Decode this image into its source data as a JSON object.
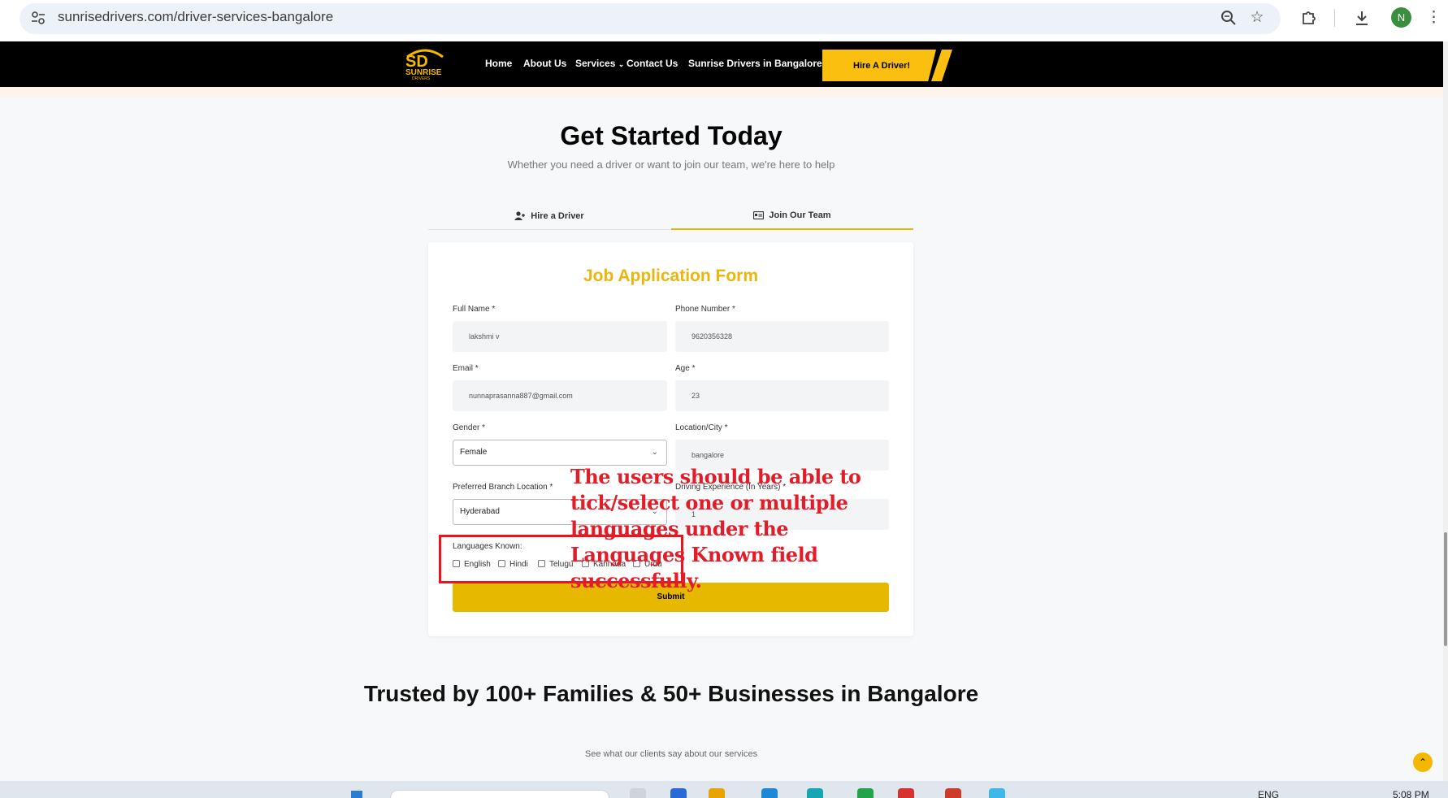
{
  "browser": {
    "url": "sunrisedrivers.com/driver-services-bangalore",
    "avatar_letter": "N",
    "icons": [
      "tune-icon",
      "zoom-icon",
      "star-icon",
      "extensions-icon",
      "download-icon",
      "menu-icon"
    ]
  },
  "nav": {
    "logo_text": "SUNRISE",
    "logo_sub": "DRIVERS",
    "links": [
      "Home",
      "About Us",
      "Services",
      "Contact Us",
      "Sunrise Drivers in Bangalore"
    ],
    "cta": "Hire A Driver!"
  },
  "hero": {
    "title": "Get Started Today",
    "subtitle": "Whether you need a driver or want to join our team, we're here to help"
  },
  "tabs": [
    {
      "label": "Hire a Driver",
      "icon": "user-plus-icon",
      "active": false
    },
    {
      "label": "Join Our Team",
      "icon": "id-card-icon",
      "active": true
    }
  ],
  "form": {
    "title": "Job Application Form",
    "full_name": {
      "label": "Full Name *",
      "value": "lakshmi v"
    },
    "phone": {
      "label": "Phone Number *",
      "value": "9620356328"
    },
    "email": {
      "label": "Email *",
      "value": "nunnaprasanna887@gmail.com"
    },
    "age": {
      "label": "Age *",
      "value": "23"
    },
    "gender": {
      "label": "Gender *",
      "value": "Female"
    },
    "location": {
      "label": "Location/City *",
      "value": "bangalore"
    },
    "branch": {
      "label": "Preferred Branch Location *",
      "value": "Hyderabad"
    },
    "experience": {
      "label": "Driving Experience (In Years) *",
      "value": "1"
    },
    "languages_label": "Languages Known:",
    "languages": [
      "English",
      "Hindi",
      "Telugu",
      "Kannada",
      "Urdu"
    ],
    "submit": "Submit"
  },
  "annotation": "The users should be able to tick/select one or multiple languages under the Languages Known field successfully.",
  "trusted": {
    "title": "Trusted by 100+ Families & 50+ Businesses in Bangalore",
    "subtitle": "See what our clients say about our services"
  },
  "taskbar": {
    "lang": "ENG",
    "time": "5:08 PM"
  },
  "colors": {
    "accent": "#e6b800",
    "nav_bg": "#000000",
    "annotation_red": "#e11d2a"
  }
}
